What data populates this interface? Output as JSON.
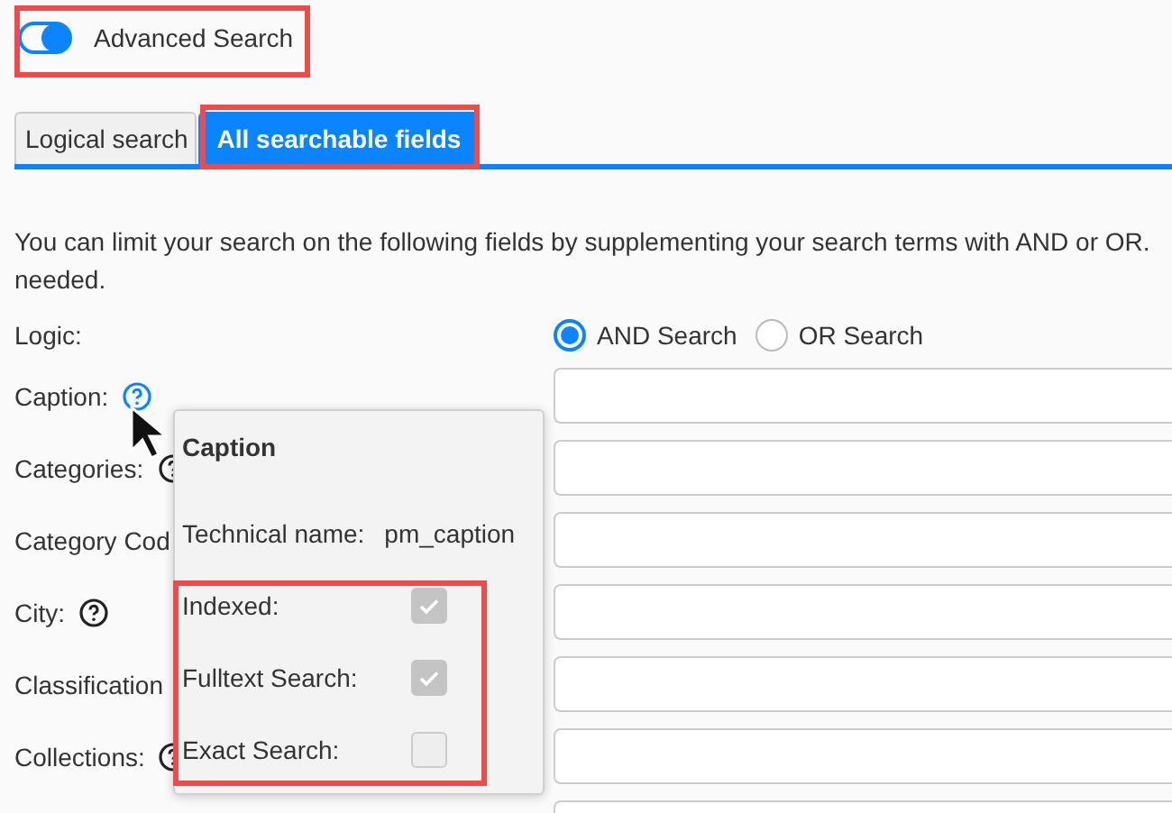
{
  "advanced_search": {
    "label": "Advanced Search",
    "on": true
  },
  "tabs": [
    {
      "label": "Logical search",
      "selected": false
    },
    {
      "label": "All searchable fields",
      "selected": true
    }
  ],
  "description": [
    "You can limit your search on the following fields by supplementing your search terms with AND or OR.",
    "needed."
  ],
  "logic": {
    "label": "Logic:",
    "options": [
      {
        "label": "AND Search",
        "selected": true
      },
      {
        "label": "OR Search",
        "selected": false
      }
    ]
  },
  "fields": [
    {
      "label": "Caption:",
      "help": true,
      "help_active": true
    },
    {
      "label": "Categories:",
      "help": true,
      "help_active": false
    },
    {
      "label": "Category Cod",
      "help": false
    },
    {
      "label": "City:",
      "help": true,
      "help_active": false
    },
    {
      "label": "Classification",
      "help": false
    },
    {
      "label": "Collections:",
      "help": true,
      "help_active": false
    }
  ],
  "tooltip": {
    "title": "Caption",
    "technical_name_label": "Technical name:",
    "technical_name": "pm_caption",
    "flags": [
      {
        "label": "Indexed:",
        "checked": true
      },
      {
        "label": "Fulltext Search:",
        "checked": true
      },
      {
        "label": "Exact Search:",
        "checked": false
      }
    ]
  }
}
